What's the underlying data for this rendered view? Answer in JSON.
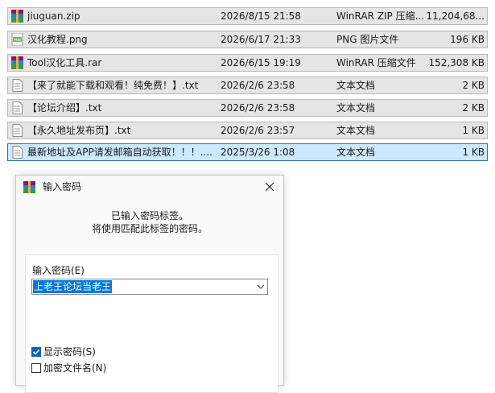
{
  "files": [
    {
      "name": "jiuguan.zip",
      "date": "2026/8/15 21:58",
      "type": "WinRAR ZIP 压缩...",
      "size": "11,204,68...",
      "icon": "winrar-archive-icon"
    },
    {
      "name": "汉化教程.png",
      "date": "2026/6/17 21:33",
      "type": "PNG 图片文件",
      "size": "196 KB",
      "icon": "png-file-icon"
    },
    {
      "name": "Tool汉化工具.rar",
      "date": "2026/6/15 19:19",
      "type": "WinRAR 压缩文件",
      "size": "152,308 KB",
      "icon": "winrar-archive-icon"
    },
    {
      "name": "【来了就能下载和观看！纯免费！】.txt",
      "date": "2026/2/6 23:58",
      "type": "文本文档",
      "size": "2 KB",
      "icon": "text-file-icon"
    },
    {
      "name": "【论坛介绍】.txt",
      "date": "2026/2/6 23:58",
      "type": "文本文档",
      "size": "2 KB",
      "icon": "text-file-icon"
    },
    {
      "name": "【永久地址发布页】.txt",
      "date": "2026/2/6 23:57",
      "type": "文本文档",
      "size": "1 KB",
      "icon": "text-file-icon"
    },
    {
      "name": "最新地址及APP请发邮箱自动获取！！！....",
      "date": "2025/3/26 1:08",
      "type": "文本文档",
      "size": "1 KB",
      "icon": "text-file-icon",
      "selected": true
    }
  ],
  "dialog": {
    "title": "输入密码",
    "info_line1": "已输入密码标签。",
    "info_line2": "将使用匹配此标签的密码。",
    "password_label": "输入密码(E)",
    "password_value": "上老王论坛当老王",
    "show_password_label": "显示密码(S)",
    "show_password_checked": true,
    "encrypt_filenames_label": "加密文件名(N)",
    "encrypt_filenames_checked": false
  },
  "colors": {
    "selection": "#cde8ff",
    "accent": "#0078d7",
    "row_bg": "#e5e5e5"
  }
}
